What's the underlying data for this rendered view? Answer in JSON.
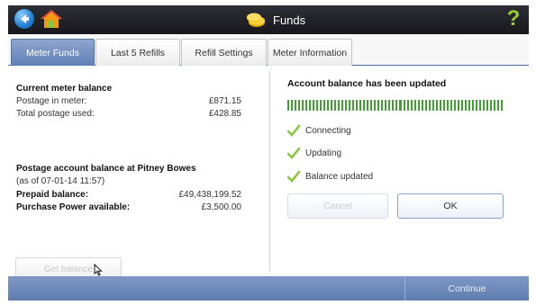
{
  "header": {
    "title": "Funds",
    "help_label": "?",
    "icons": {
      "back": "back-arrow-icon",
      "home": "home-icon",
      "title": "coins-icon"
    }
  },
  "tabs": [
    {
      "label": "Meter Funds",
      "active": true
    },
    {
      "label": "Last 5 Refills",
      "active": false
    },
    {
      "label": "Refill Settings",
      "active": false
    },
    {
      "label": "Meter Information",
      "active": false
    }
  ],
  "meter": {
    "heading": "Current meter balance",
    "postage_label": "Postage in meter:",
    "postage_value": "£871.15",
    "used_label": "Total postage used:",
    "used_value": "£428.85"
  },
  "account": {
    "heading": "Postage account balance at Pitney Bowes",
    "as_of": "(as of 07-01-14  11:57)",
    "prepaid_label": "Prepaid balance:",
    "prepaid_value": "£49,438,199.52",
    "power_label": "Purchase Power available:",
    "power_value": "£3,500.00"
  },
  "get_balance_label": "Get balance",
  "status": {
    "heading": "Account balance has been updated",
    "progress": 1.0,
    "steps": [
      "Connecting",
      "Updating",
      "Balance updated"
    ]
  },
  "buttons": {
    "cancel": "Cancel",
    "ok": "OK",
    "continue": "Continue"
  },
  "colors": {
    "accent": "#5f7fb4",
    "progress": "#3fa02f",
    "check": "#8dc63f",
    "help": "#9acd32"
  }
}
